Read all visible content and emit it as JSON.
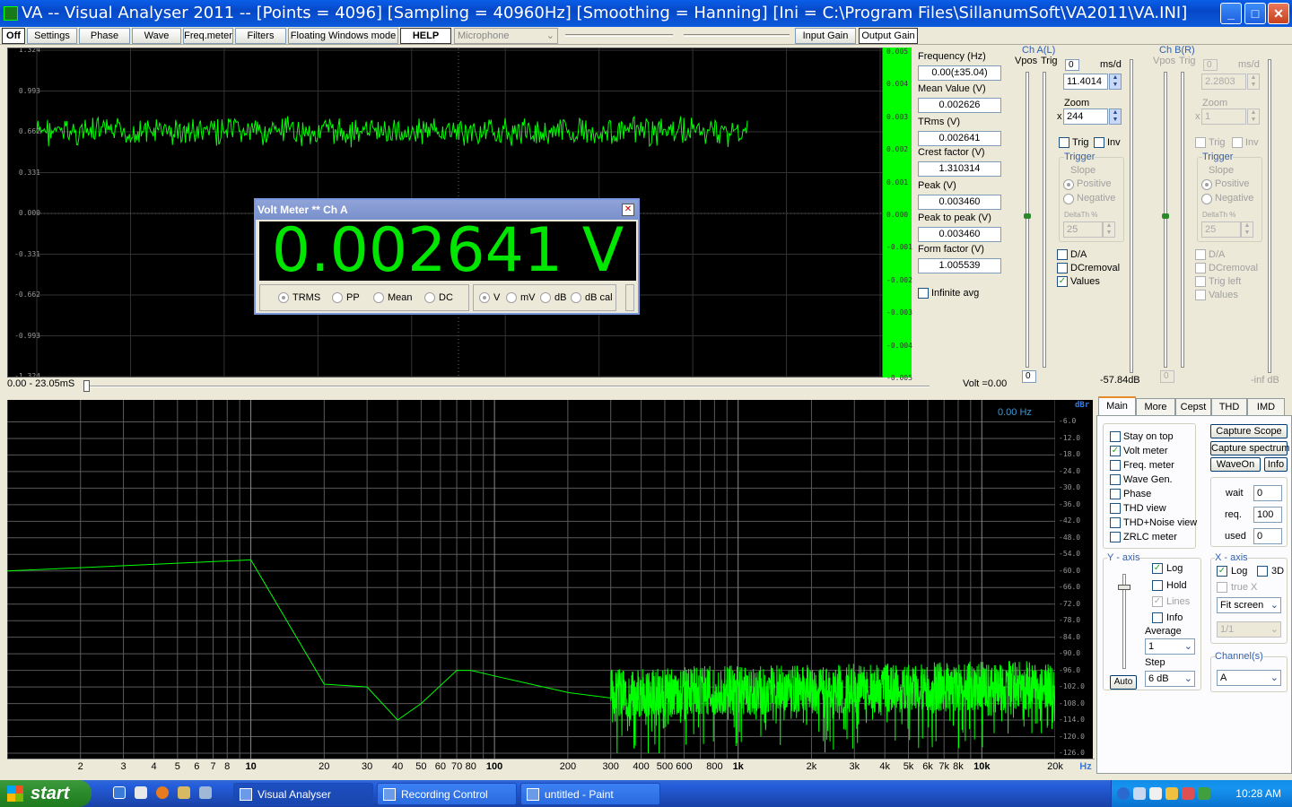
{
  "window": {
    "title": "VA -- Visual Analyser 2011 --  [Points = 4096]  [Sampling = 40960Hz]  [Smoothing = Hanning]  [Ini = C:\\Program Files\\SillanumSoft\\VA2011\\VA.INI]"
  },
  "toolbar": {
    "off": "Off",
    "settings": "Settings",
    "phase": "Phase",
    "wave": "Wave",
    "freqmeter": "Freq.meter",
    "filters": "Filters",
    "floating": "Floating Windows mode",
    "help": "HELP",
    "input_source": "Microphone",
    "input_gain": "Input Gain",
    "output_gain": "Output Gain"
  },
  "scope": {
    "ylabels": [
      "1.324",
      "0.993",
      "0.662",
      "0.331",
      "0.000",
      "-0.331",
      "-0.662",
      "-0.993",
      "-1.324"
    ],
    "time_range": "0.00 - 23.05mS",
    "volt": "Volt =0.00",
    "signal_level": 0.662,
    "signal_end_fraction": 0.84
  },
  "vu": {
    "labels": [
      "0.005",
      "0.004",
      "0.003",
      "0.002",
      "0.001",
      "0.000",
      "-0.001",
      "-0.002",
      "-0.003",
      "-0.004",
      "-0.005"
    ]
  },
  "measures": [
    {
      "label": "Frequency (Hz)",
      "value": "0.00(±35.04)"
    },
    {
      "label": "Mean Value (V)",
      "value": "0.002626"
    },
    {
      "label": "TRms (V)",
      "value": "0.002641"
    },
    {
      "label": "Crest factor (V)",
      "value": "1.310314"
    },
    {
      "label": "Peak (V)",
      "value": "0.003460"
    },
    {
      "label": "Peak to peak (V)",
      "value": "0.003460"
    },
    {
      "label": "Form factor (V)",
      "value": "1.005539"
    }
  ],
  "infinite_avg": "Infinite avg",
  "chA": {
    "title": "Ch A(L)",
    "vpos": "Vpos",
    "trig": "Trig",
    "msd_value": "0",
    "msd": "ms/d",
    "msd_input": "11.4014",
    "zoom": "Zoom",
    "x": "x",
    "zoom_value": "244",
    "trig_chk": "Trig",
    "inv": "Inv",
    "trigger": "Trigger",
    "slope": "Slope",
    "positive": "Positive",
    "negative": "Negative",
    "deltath": "DeltaTh %",
    "deltath_value": "25",
    "da": "D/A",
    "dcremoval": "DCremoval",
    "values": "Values",
    "zero": "0",
    "db": "-57.84dB"
  },
  "chB": {
    "title": "Ch B(R)",
    "vpos": "Vpos",
    "trig": "Trig",
    "msd_value": "0",
    "msd": "ms/d",
    "msd_input": "2.2803",
    "zoom": "Zoom",
    "x": "x",
    "zoom_value": "1",
    "trig_chk": "Trig",
    "inv": "Inv",
    "trigger": "Trigger",
    "slope": "Slope",
    "positive": "Positive",
    "negative": "Negative",
    "deltath": "DeltaTh %",
    "deltath_value": "25",
    "da": "D/A",
    "dcremoval": "DCremoval",
    "trigleft": "Trig left",
    "values": "Values",
    "zero": "0",
    "db": "-inf dB"
  },
  "voltmeter": {
    "title": "Volt Meter ** Ch A",
    "reading": "0.002641  V",
    "modes": [
      "TRMS",
      "PP",
      "Mean",
      "DC"
    ],
    "units": [
      "V",
      "mV",
      "dB",
      "dB cal"
    ]
  },
  "spectrum": {
    "freq_readout": "0.00 Hz",
    "db_unit": "dBr",
    "db_labels": [
      "-6.0",
      "-12.0",
      "-18.0",
      "-24.0",
      "-30.0",
      "-36.0",
      "-42.0",
      "-48.0",
      "-54.0",
      "-60.0",
      "-66.0",
      "-72.0",
      "-78.0",
      "-84.0",
      "-90.0",
      "-96.0",
      "-102.0",
      "-108.0",
      "-114.0",
      "-120.0",
      "-126.0"
    ],
    "x_labels": [
      {
        "t": "2",
        "f": 2
      },
      {
        "t": "3",
        "f": 3
      },
      {
        "t": "4",
        "f": 4
      },
      {
        "t": "5",
        "f": 5
      },
      {
        "t": "6",
        "f": 6
      },
      {
        "t": "7",
        "f": 7
      },
      {
        "t": "8",
        "f": 8
      },
      {
        "t": "10",
        "f": 10,
        "b": true
      },
      {
        "t": "20",
        "f": 20
      },
      {
        "t": "30",
        "f": 30
      },
      {
        "t": "40",
        "f": 40
      },
      {
        "t": "50",
        "f": 50
      },
      {
        "t": "60",
        "f": 60
      },
      {
        "t": "70",
        "f": 70
      },
      {
        "t": "80",
        "f": 80
      },
      {
        "t": "100",
        "f": 100,
        "b": true
      },
      {
        "t": "200",
        "f": 200
      },
      {
        "t": "300",
        "f": 300
      },
      {
        "t": "400",
        "f": 400
      },
      {
        "t": "500",
        "f": 500
      },
      {
        "t": "600",
        "f": 600
      },
      {
        "t": "800",
        "f": 800
      },
      {
        "t": "1k",
        "f": 1000,
        "b": true
      },
      {
        "t": "2k",
        "f": 2000
      },
      {
        "t": "3k",
        "f": 3000
      },
      {
        "t": "4k",
        "f": 4000
      },
      {
        "t": "5k",
        "f": 5000
      },
      {
        "t": "6k",
        "f": 6000
      },
      {
        "t": "7k",
        "f": 7000
      },
      {
        "t": "8k",
        "f": 8000
      },
      {
        "t": "10k",
        "f": 10000,
        "b": true
      },
      {
        "t": "20k",
        "f": 20000
      }
    ],
    "hz_unit": "Hz",
    "trace": [
      [
        1,
        -60
      ],
      [
        10,
        -56
      ],
      [
        20,
        -101
      ],
      [
        30,
        -102
      ],
      [
        40,
        -114
      ],
      [
        50,
        -108
      ],
      [
        70,
        -96
      ],
      [
        80,
        -96
      ],
      [
        100,
        -98
      ],
      [
        200,
        -104
      ],
      [
        300,
        -106
      ]
    ]
  },
  "tabs": [
    "Main",
    "More",
    "Cepst",
    "THD",
    "IMD"
  ],
  "main": {
    "options": [
      {
        "label": "Stay on top",
        "on": false
      },
      {
        "label": "Volt meter",
        "on": true
      },
      {
        "label": "Freq. meter",
        "on": false
      },
      {
        "label": "Wave Gen.",
        "on": false
      },
      {
        "label": "Phase",
        "on": false
      },
      {
        "label": "THD view",
        "on": false
      },
      {
        "label": "THD+Noise view",
        "on": false
      },
      {
        "label": "ZRLC meter",
        "on": false
      }
    ],
    "capture_scope": "Capture Scope",
    "capture_spectrum": "Capture spectrum",
    "waveon": "WaveOn",
    "info": "Info",
    "wait": "wait",
    "wait_v": "0",
    "req": "req.",
    "req_v": "100",
    "used": "used",
    "used_v": "0",
    "yaxis": "Y - axis",
    "log": "Log",
    "hold": "Hold",
    "lines": "Lines",
    "info_chk": "Info",
    "average": "Average",
    "average_v": "1",
    "step": "Step",
    "step_v": "6 dB",
    "auto": "Auto",
    "xaxis": "X - axis",
    "xlog": "Log",
    "x3d": "3D",
    "truex": "true X",
    "fit": "Fit screen",
    "ratio": "1/1",
    "channels": "Channel(s)",
    "channel_v": "A"
  },
  "taskbar": {
    "start": "start",
    "tasks": [
      "Visual Analyser",
      "Recording Control",
      "untitled - Paint"
    ],
    "clock": "10:28 AM"
  }
}
